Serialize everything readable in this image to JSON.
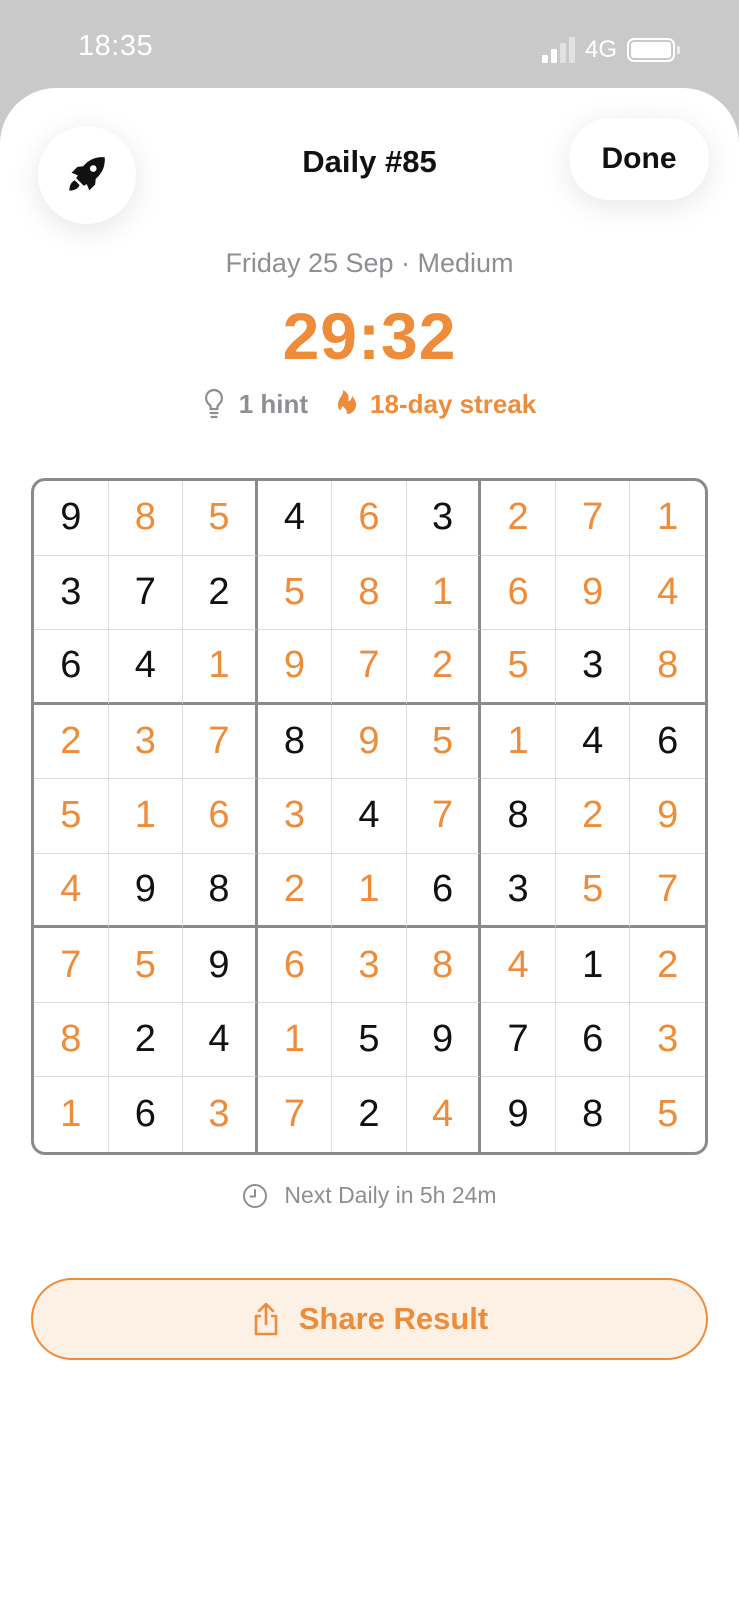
{
  "status_bar": {
    "time": "18:35",
    "network": "4G",
    "battery_level": 1.0
  },
  "header": {
    "title": "Daily #85",
    "done_label": "Done",
    "left_icon": "rocket-icon"
  },
  "puzzle": {
    "subtitle": "Friday 25 Sep · Medium",
    "timer": "29:32",
    "hint_label": "1 hint",
    "streak_label": "18-day streak"
  },
  "board": {
    "values": [
      [
        9,
        8,
        5,
        4,
        6,
        3,
        2,
        7,
        1
      ],
      [
        3,
        7,
        2,
        5,
        8,
        1,
        6,
        9,
        4
      ],
      [
        6,
        4,
        1,
        9,
        7,
        2,
        5,
        3,
        8
      ],
      [
        2,
        3,
        7,
        8,
        9,
        5,
        1,
        4,
        6
      ],
      [
        5,
        1,
        6,
        3,
        4,
        7,
        8,
        2,
        9
      ],
      [
        4,
        9,
        8,
        2,
        1,
        6,
        3,
        5,
        7
      ],
      [
        7,
        5,
        9,
        6,
        3,
        8,
        4,
        1,
        2
      ],
      [
        8,
        2,
        4,
        1,
        5,
        9,
        7,
        6,
        3
      ],
      [
        1,
        6,
        3,
        7,
        2,
        4,
        9,
        8,
        5
      ]
    ],
    "given": [
      [
        1,
        0,
        0,
        1,
        0,
        1,
        0,
        0,
        0
      ],
      [
        1,
        1,
        1,
        0,
        0,
        0,
        0,
        0,
        0
      ],
      [
        1,
        1,
        0,
        0,
        0,
        0,
        0,
        1,
        0
      ],
      [
        0,
        0,
        0,
        1,
        0,
        0,
        0,
        1,
        1
      ],
      [
        0,
        0,
        0,
        0,
        1,
        0,
        1,
        0,
        0
      ],
      [
        0,
        1,
        1,
        0,
        0,
        1,
        1,
        0,
        0
      ],
      [
        0,
        0,
        1,
        0,
        0,
        0,
        0,
        1,
        0
      ],
      [
        0,
        1,
        1,
        0,
        1,
        1,
        1,
        1,
        0
      ],
      [
        0,
        1,
        0,
        0,
        1,
        0,
        1,
        1,
        0
      ]
    ]
  },
  "footer": {
    "next_daily": "Next Daily in 5h 24m",
    "share_label": "Share Result"
  },
  "colors": {
    "accent": "#ee8c3a",
    "given_text": "#111111",
    "muted": "#8e8e93"
  }
}
